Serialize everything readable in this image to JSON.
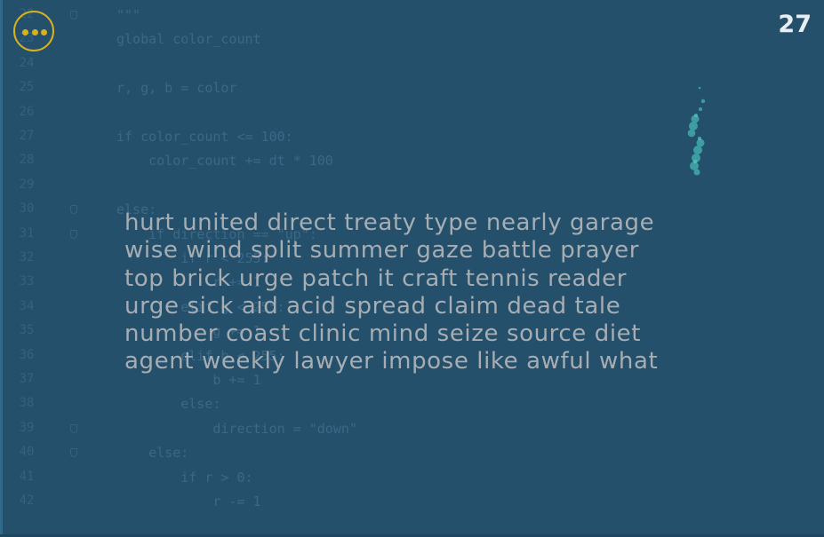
{
  "hud": {
    "menu_icon": "more-dots-icon",
    "counter": "27"
  },
  "colors": {
    "background": "#25506c",
    "accent": "#d9b21b",
    "word_text": "#a6adb3",
    "particles": "#3fa7a7"
  },
  "editor_background": {
    "line_numbers": [
      "22",
      "23",
      "24",
      "25",
      "26",
      "27",
      "28",
      "29",
      "30",
      "31",
      "32",
      "33",
      "34",
      "35",
      "36",
      "37",
      "38",
      "39",
      "40",
      "41",
      "42"
    ],
    "lines": [
      "\"\"\"",
      "global color_count",
      "",
      "r, g, b = color",
      "",
      "if color_count <= 100:",
      "    color_count += dt * 100",
      "",
      "else:",
      "    if direction == \"up\":",
      "        if r < 255:",
      "            r += 1",
      "        elif g < 255:",
      "            g += 1",
      "        elif b < 255:",
      "            b += 1",
      "        else:",
      "            direction = \"down\"",
      "    else:",
      "        if r > 0:",
      "            r -= 1"
    ]
  },
  "word_lines": [
    "hurt united direct treaty type nearly garage",
    "wise wind split summer gaze battle prayer",
    "top brick urge patch it craft tennis reader",
    "urge sick aid acid spread claim dead tale",
    "number coast clinic mind seize source diet",
    "agent weekly lawyer impose like awful what"
  ]
}
